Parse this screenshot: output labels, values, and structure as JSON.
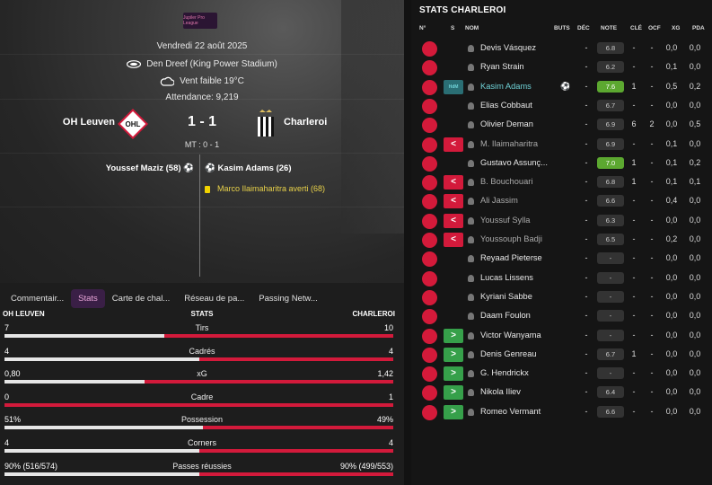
{
  "match": {
    "competition_logo": "Jupiler Pro League",
    "date": "Vendredi 22 août 2025",
    "stadium": "Den Dreef (King Power Stadium)",
    "weather": "Vent faible 19°C",
    "attendance": "Attendance:  9,219",
    "home": "OH Leuven",
    "away": "Charleroi",
    "score": "1 - 1",
    "halftime": "MT : 0 - 1",
    "scorer_home": "Youssef Maziz (58)",
    "scorer_away": "Kasim Adams (26)",
    "booking": "Marco Ilaimaharitra averti (68)",
    "home_badge_text": "OHL"
  },
  "tabs": [
    "Commentair...",
    "Stats",
    "Carte de chal...",
    "Réseau de pa...",
    "Passing Netw..."
  ],
  "stats": {
    "home_label": "OH LEUVEN",
    "center_label": "STATS",
    "away_label": "CHARLEROI",
    "rows": [
      {
        "label": "Tirs",
        "home": "7",
        "away": "10",
        "home_share": 0.412
      },
      {
        "label": "Cadrés",
        "home": "4",
        "away": "4",
        "home_share": 0.5
      },
      {
        "label": "xG",
        "home": "0,80",
        "away": "1,42",
        "home_share": 0.36
      },
      {
        "label": "Cadre",
        "home": "0",
        "away": "1",
        "home_share": 0.0
      },
      {
        "label": "Possession",
        "home": "51%",
        "away": "49%",
        "home_share": 0.51
      },
      {
        "label": "Corners",
        "home": "4",
        "away": "4",
        "home_share": 0.5
      },
      {
        "label": "Passes réussies",
        "home": "90% (516/574)",
        "away": "90% (499/553)",
        "home_share": 0.5
      }
    ]
  },
  "player_panel": {
    "title": "STATS CHARLEROI",
    "columns": [
      "N°",
      "S",
      "NOM",
      "BUTS",
      "DÉC",
      "NOTE",
      "CLÉ",
      "OCF",
      "XG",
      "PDA"
    ],
    "players": [
      {
        "sub": "",
        "name": "Devis Vásquez",
        "goal": "",
        "dec": "-",
        "note": "6.8",
        "cle": "-",
        "ocf": "-",
        "xg": "0,0",
        "pda": "0,0"
      },
      {
        "sub": "",
        "name": "Ryan Strain",
        "goal": "",
        "dec": "-",
        "note": "6.2",
        "cle": "-",
        "ocf": "-",
        "xg": "0,1",
        "pda": "0,0"
      },
      {
        "sub": "motm",
        "sub_text": "HdM",
        "name": "Kasim Adams",
        "goal": "⚽",
        "dec": "-",
        "note": "7.6",
        "cle": "1",
        "ocf": "-",
        "xg": "0,5",
        "pda": "0,2"
      },
      {
        "sub": "",
        "name": "Elias Cobbaut",
        "goal": "",
        "dec": "-",
        "note": "6.7",
        "cle": "-",
        "ocf": "-",
        "xg": "0,0",
        "pda": "0,0"
      },
      {
        "sub": "",
        "name": "Olivier Deman",
        "goal": "",
        "dec": "-",
        "note": "6.9",
        "cle": "6",
        "ocf": "2",
        "xg": "0,0",
        "pda": "0,5"
      },
      {
        "sub": "out",
        "name": "M. Ilaimaharitra",
        "goal": "",
        "dec": "-",
        "note": "6.9",
        "cle": "-",
        "ocf": "-",
        "xg": "0,1",
        "pda": "0,0"
      },
      {
        "sub": "",
        "name": "Gustavo Assunç...",
        "goal": "",
        "dec": "-",
        "note": "7.0",
        "cle": "1",
        "ocf": "-",
        "xg": "0,1",
        "pda": "0,2"
      },
      {
        "sub": "out",
        "name": "B. Bouchouari",
        "goal": "",
        "dec": "-",
        "note": "6.8",
        "cle": "1",
        "ocf": "-",
        "xg": "0,1",
        "pda": "0,1"
      },
      {
        "sub": "out",
        "name": "Ali Jassim",
        "goal": "",
        "dec": "-",
        "note": "6.6",
        "cle": "-",
        "ocf": "-",
        "xg": "0,4",
        "pda": "0,0"
      },
      {
        "sub": "out",
        "name": "Youssuf Sylla",
        "goal": "",
        "dec": "-",
        "note": "6.3",
        "cle": "-",
        "ocf": "-",
        "xg": "0,0",
        "pda": "0,0"
      },
      {
        "sub": "out",
        "name": "Youssouph Badji",
        "goal": "",
        "dec": "-",
        "note": "6.5",
        "cle": "-",
        "ocf": "-",
        "xg": "0,2",
        "pda": "0,0"
      },
      {
        "sub": "",
        "name": "Reyaad Pieterse",
        "goal": "",
        "dec": "-",
        "note": "-",
        "cle": "-",
        "ocf": "-",
        "xg": "0,0",
        "pda": "0,0"
      },
      {
        "sub": "",
        "name": "Lucas Lissens",
        "goal": "",
        "dec": "-",
        "note": "-",
        "cle": "-",
        "ocf": "-",
        "xg": "0,0",
        "pda": "0,0"
      },
      {
        "sub": "",
        "name": "Kyriani Sabbe",
        "goal": "",
        "dec": "-",
        "note": "-",
        "cle": "-",
        "ocf": "-",
        "xg": "0,0",
        "pda": "0,0"
      },
      {
        "sub": "",
        "name": "Daam Foulon",
        "goal": "",
        "dec": "-",
        "note": "-",
        "cle": "-",
        "ocf": "-",
        "xg": "0,0",
        "pda": "0,0"
      },
      {
        "sub": "in",
        "name": "Victor Wanyama",
        "goal": "",
        "dec": "-",
        "note": "-",
        "cle": "-",
        "ocf": "-",
        "xg": "0,0",
        "pda": "0,0"
      },
      {
        "sub": "in",
        "name": "Denis Genreau",
        "goal": "",
        "dec": "-",
        "note": "6.7",
        "cle": "1",
        "ocf": "-",
        "xg": "0,0",
        "pda": "0,0"
      },
      {
        "sub": "in",
        "name": "G. Hendrickx",
        "goal": "",
        "dec": "-",
        "note": "-",
        "cle": "-",
        "ocf": "-",
        "xg": "0,0",
        "pda": "0,0"
      },
      {
        "sub": "in",
        "name": "Nikola Iliev",
        "goal": "",
        "dec": "-",
        "note": "6.4",
        "cle": "-",
        "ocf": "-",
        "xg": "0,0",
        "pda": "0,0"
      },
      {
        "sub": "in",
        "name": "Romeo Vermant",
        "goal": "",
        "dec": "-",
        "note": "6.6",
        "cle": "-",
        "ocf": "-",
        "xg": "0,0",
        "pda": "0,0"
      }
    ]
  },
  "colors": {
    "accent": "#d31a3b",
    "sub_in": "#36a04a",
    "highlight": "#6fd1d6",
    "rating_good": "#5ca830"
  }
}
